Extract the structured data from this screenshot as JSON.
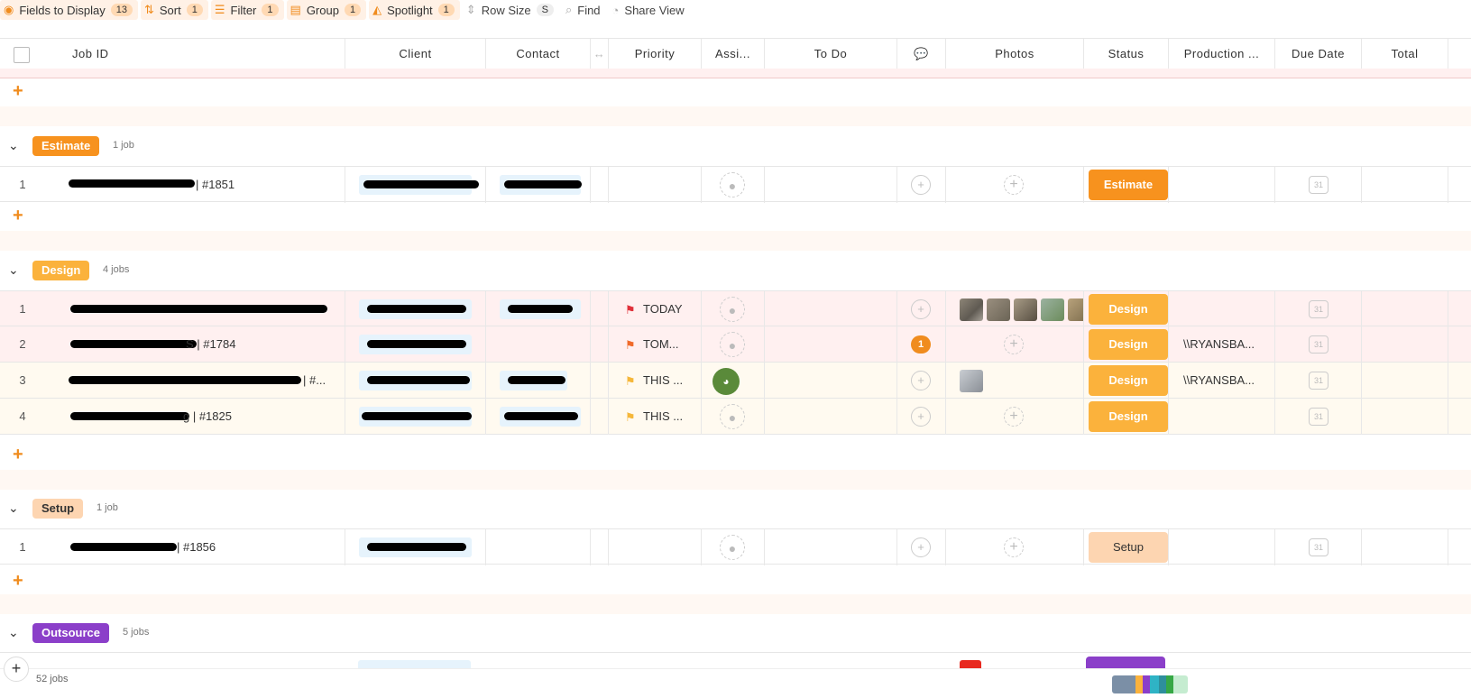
{
  "toolbar": {
    "fields": {
      "label": "Fields to Display",
      "count": "13"
    },
    "sort": {
      "label": "Sort",
      "count": "1"
    },
    "filter": {
      "label": "Filter",
      "count": "1"
    },
    "group": {
      "label": "Group",
      "count": "1"
    },
    "spotlight": {
      "label": "Spotlight",
      "count": "1"
    },
    "rowsize": {
      "label": "Row Size",
      "count": "S"
    },
    "find": {
      "label": "Find"
    },
    "share": {
      "label": "Share View"
    }
  },
  "columns": {
    "job_id": "Job ID",
    "client": "Client",
    "contact": "Contact",
    "priority": "Priority",
    "assignee": "Assi...",
    "todo": "To Do",
    "photos": "Photos",
    "status": "Status",
    "production": "Production ...",
    "due_date": "Due Date",
    "total": "Total"
  },
  "groups": {
    "estimate": {
      "label": "Estimate",
      "count": "1 job",
      "color": "#f7921e",
      "rows": [
        {
          "num": "1",
          "job": "| #1851",
          "status": "Estimate"
        }
      ]
    },
    "design": {
      "label": "Design",
      "count": "4 jobs",
      "color": "#fbb23c",
      "rows": [
        {
          "num": "1",
          "job": "",
          "priority": "TODAY",
          "priority_color": "#e0303a",
          "comments": "",
          "production": "",
          "status": "Design"
        },
        {
          "num": "2",
          "job": "S | #1784",
          "priority": "TOM...",
          "priority_color": "#f06a2a",
          "comments": "1",
          "production": "\\\\RYANSBA...",
          "status": "Design"
        },
        {
          "num": "3",
          "job": "| #...",
          "priority": "THIS ...",
          "priority_color": "#f5b73a",
          "comments": "",
          "production": "\\\\RYANSBA...",
          "status": "Design"
        },
        {
          "num": "4",
          "job": "g | #1825",
          "priority": "THIS ...",
          "priority_color": "#f5b73a",
          "comments": "",
          "production": "",
          "status": "Design"
        }
      ]
    },
    "setup": {
      "label": "Setup",
      "count": "1 job",
      "color": "#fdd5b1",
      "rows": [
        {
          "num": "1",
          "job": "| #1856",
          "status": "Setup"
        }
      ]
    },
    "outsource": {
      "label": "Outsource",
      "count": "5 jobs",
      "color": "#8b3fc9"
    }
  },
  "footer": {
    "count": "52 jobs",
    "add": "+"
  },
  "calendar_day": "31",
  "status_colors": {
    "estimate": "#f7921e",
    "design": "#fbb23c",
    "setup": "#fdd5b1",
    "outsource": "#8b3fc9"
  }
}
